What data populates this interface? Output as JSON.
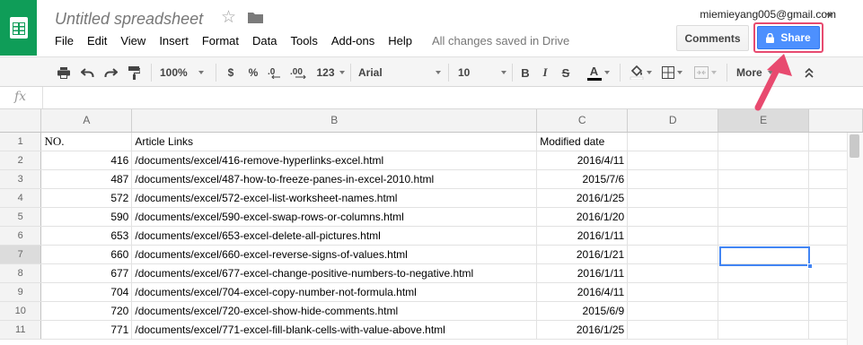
{
  "header": {
    "doc_title": "Untitled spreadsheet",
    "account_email": "miemieyang005@gmail.com",
    "comments_label": "Comments",
    "share_label": "Share",
    "save_status": "All changes saved in Drive"
  },
  "menu": [
    "File",
    "Edit",
    "View",
    "Insert",
    "Format",
    "Data",
    "Tools",
    "Add-ons",
    "Help"
  ],
  "toolbar": {
    "zoom": "100%",
    "currency": "$",
    "percent": "%",
    "decrease_decimals": ".0",
    "increase_decimals": ".00",
    "more_formats": "123",
    "font": "Arial",
    "font_size": "10",
    "bold": "B",
    "italic": "I",
    "strikethrough": "S",
    "text_color": "A",
    "more": "More"
  },
  "formula_bar": {
    "fx": "fx",
    "content": ""
  },
  "columns": [
    "A",
    "B",
    "C",
    "D",
    "E"
  ],
  "rows": [
    {
      "n": "1",
      "a": "NO.",
      "b": "Article Links",
      "c": "Modified date"
    },
    {
      "n": "2",
      "a": "416",
      "b": "/documents/excel/416-remove-hyperlinks-excel.html",
      "c": "2016/4/11"
    },
    {
      "n": "3",
      "a": "487",
      "b": "/documents/excel/487-how-to-freeze-panes-in-excel-2010.html",
      "c": "2015/7/6"
    },
    {
      "n": "4",
      "a": "572",
      "b": "/documents/excel/572-excel-list-worksheet-names.html",
      "c": "2016/1/25"
    },
    {
      "n": "5",
      "a": "590",
      "b": "/documents/excel/590-excel-swap-rows-or-columns.html",
      "c": "2016/1/20"
    },
    {
      "n": "6",
      "a": "653",
      "b": "/documents/excel/653-excel-delete-all-pictures.html",
      "c": "2016/1/11"
    },
    {
      "n": "7",
      "a": "660",
      "b": "/documents/excel/660-excel-reverse-signs-of-values.html",
      "c": "2016/1/21"
    },
    {
      "n": "8",
      "a": "677",
      "b": "/documents/excel/677-excel-change-positive-numbers-to-negative.html",
      "c": "2016/1/11"
    },
    {
      "n": "9",
      "a": "704",
      "b": "/documents/excel/704-excel-copy-number-not-formula.html",
      "c": "2016/4/11"
    },
    {
      "n": "10",
      "a": "720",
      "b": "/documents/excel/720-excel-show-hide-comments.html",
      "c": "2015/6/9"
    },
    {
      "n": "11",
      "a": "771",
      "b": "/documents/excel/771-excel-fill-blank-cells-with-value-above.html",
      "c": "2016/1/25"
    }
  ],
  "selected_cell": "E7",
  "colors": {
    "brand_green": "#0f9d58",
    "share_blue": "#4d90fe",
    "annotation_pink": "#e84a6f",
    "selection_blue": "#4285f4"
  }
}
